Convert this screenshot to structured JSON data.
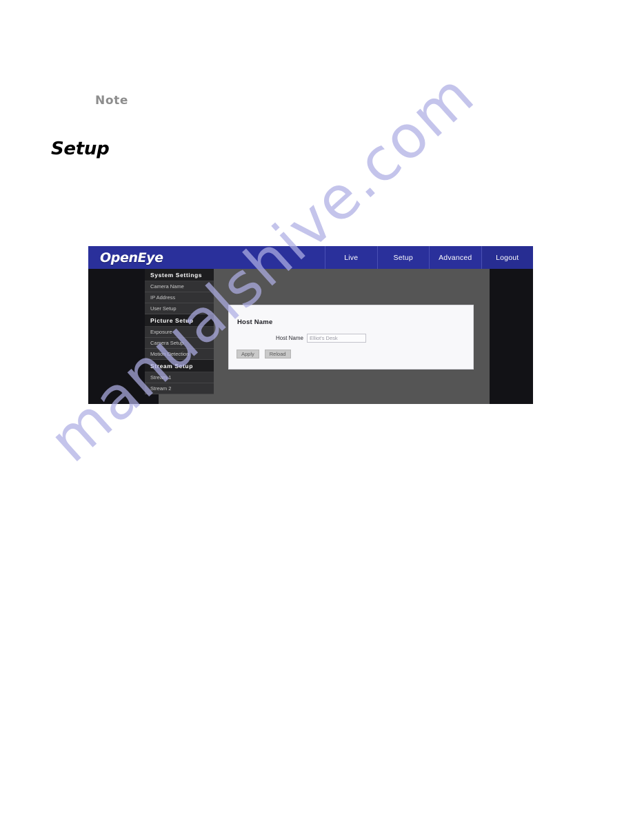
{
  "document": {
    "note_label": "Note",
    "section_heading": "Setup"
  },
  "watermark": {
    "text": "manualshive.com",
    "color": "#aeaee4"
  },
  "screenshot": {
    "brand": "OpenEye",
    "colors": {
      "header_blue": "#2a309b",
      "sidebar_dark": "#121216",
      "content_gray": "#555555",
      "panel_bg": "#f8f8fa"
    },
    "nav_tabs": [
      {
        "label": "Live"
      },
      {
        "label": "Setup"
      },
      {
        "label": "Advanced"
      },
      {
        "label": "Logout"
      }
    ],
    "sidebar": {
      "groups": [
        {
          "header": "System Settings",
          "items": [
            {
              "label": "Camera Name"
            },
            {
              "label": "IP Address"
            },
            {
              "label": "User Setup"
            }
          ]
        },
        {
          "header": "Picture Setup",
          "items": [
            {
              "label": "Exposure"
            },
            {
              "label": "Camera Setup"
            },
            {
              "label": "Motion Detection"
            }
          ]
        },
        {
          "header": "Stream  Setup",
          "items": [
            {
              "label": "Stream 1"
            },
            {
              "label": "Stream 2"
            }
          ]
        }
      ]
    },
    "panel": {
      "title": "Host Name",
      "field_label": "Host Name",
      "field_value": "Elliot's Desk",
      "field_placeholder": "Elliot's Desk",
      "buttons": [
        {
          "label": "Apply"
        },
        {
          "label": "Reload"
        }
      ]
    }
  }
}
